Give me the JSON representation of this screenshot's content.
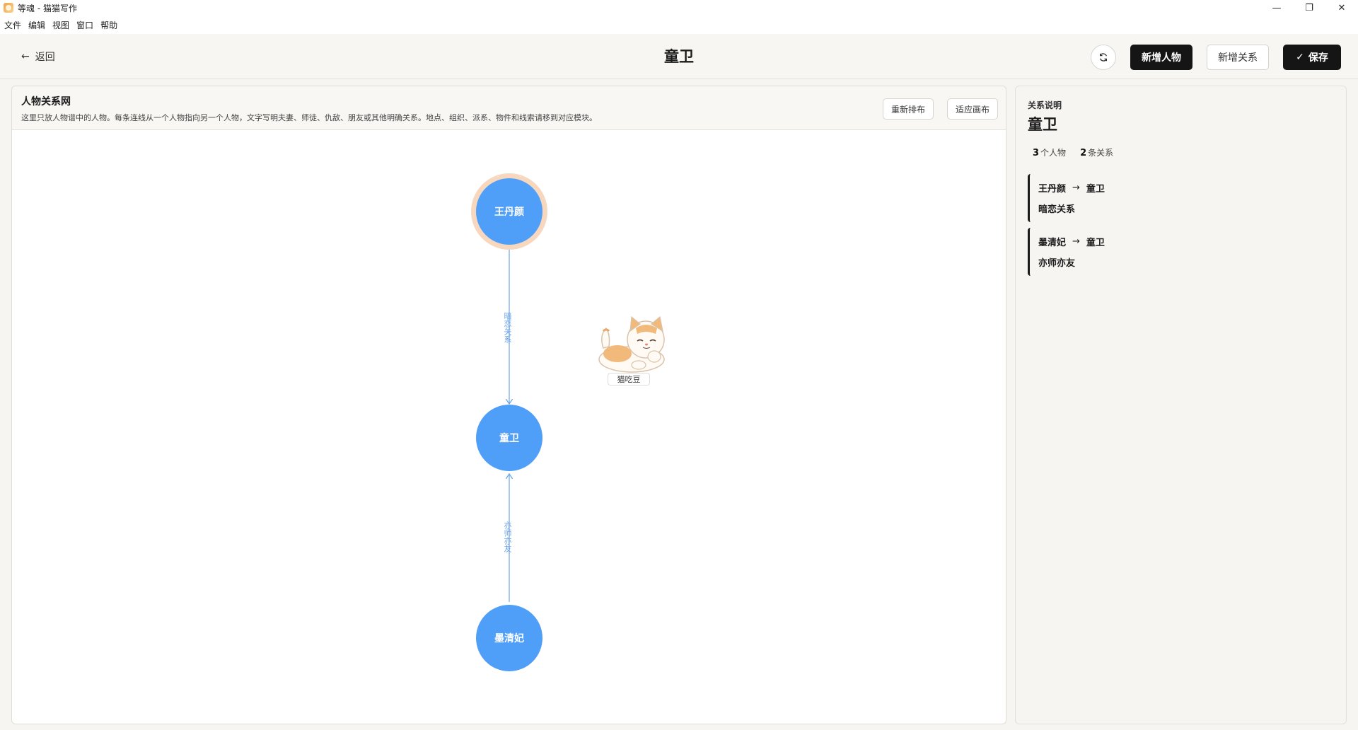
{
  "window": {
    "title": "等魂 - 猫猫写作",
    "controls": [
      "—",
      "❐",
      "✕"
    ]
  },
  "menu": [
    "文件",
    "编辑",
    "视图",
    "窗口",
    "帮助"
  ],
  "toolbar": {
    "back_label": "返回",
    "title": "童卫",
    "add_person_label": "新增人物",
    "add_relation_label": "新增关系",
    "save_label": "保存"
  },
  "graph": {
    "title": "人物关系网",
    "description": "这里只放人物谱中的人物。每条连线从一个人物指向另一个人物，文字写明夫妻、师徒、仇敌、朋友或其他明确关系。地点、组织、派系、物件和线索请移到对应模块。",
    "relayout_label": "重新排布",
    "fit_label": "适应画布",
    "nodes": [
      {
        "name": "王丹颜",
        "selected": true
      },
      {
        "name": "童卫",
        "selected": false
      },
      {
        "name": "墨清妃",
        "selected": false
      }
    ],
    "edges": [
      {
        "from": "王丹颜",
        "to": "童卫",
        "label": "暗恋关系"
      },
      {
        "from": "墨清妃",
        "to": "童卫",
        "label": "亦师亦友"
      }
    ],
    "mascot_name": "猫吃豆"
  },
  "sidebar": {
    "label": "关系说明",
    "title": "童卫",
    "person_count": "3",
    "person_unit": "个人物",
    "relation_count": "2",
    "relation_unit": "条关系",
    "relations": [
      {
        "from": "王丹颜",
        "arrow": "→",
        "to": "童卫",
        "desc": "暗恋关系"
      },
      {
        "from": "墨清妃",
        "arrow": "→",
        "to": "童卫",
        "desc": "亦师亦友"
      }
    ]
  }
}
